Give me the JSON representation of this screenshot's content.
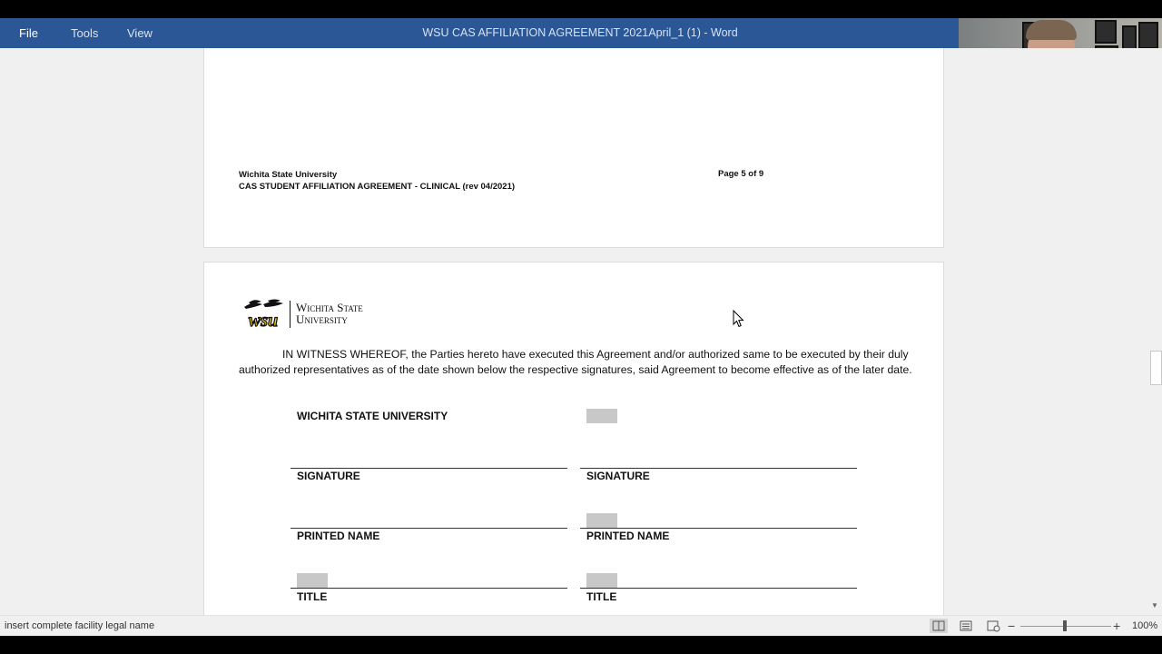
{
  "menu": {
    "file": "File",
    "tools": "Tools",
    "view": "View"
  },
  "window_title": "WSU CAS AFFILIATION AGREEMENT 2021April_1 (1) - Word",
  "page_footer": {
    "org": "Wichita State University",
    "doc": "CAS STUDENT AFFILIATION AGREEMENT - CLINICAL (rev 04/2021)",
    "page": "Page 5 of 9"
  },
  "logo": {
    "mark": "wsu",
    "line1": "Wichita State",
    "line2": "University"
  },
  "witness_text": "IN WITNESS WHEREOF, the Parties hereto have executed this Agreement and/or authorized same to be executed by their duly authorized representatives as of the date shown below the respective signatures, said Agreement to become effective as of the later date.",
  "signature_block": {
    "left_heading": "WICHITA STATE UNIVERSITY",
    "signature_label": "SIGNATURE",
    "printed_name_label": "PRINTED NAME",
    "title_label": "TITLE"
  },
  "status": {
    "text": "insert complete facility legal name",
    "zoom": "100%"
  },
  "icons": [
    "cursor-arrow-icon",
    "read-mode-icon",
    "print-layout-icon",
    "web-layout-icon",
    "zoom-minus-icon",
    "zoom-plus-icon"
  ],
  "colors": {
    "titlebar": "#2b5797",
    "placeholder": "#c8c8c8"
  }
}
